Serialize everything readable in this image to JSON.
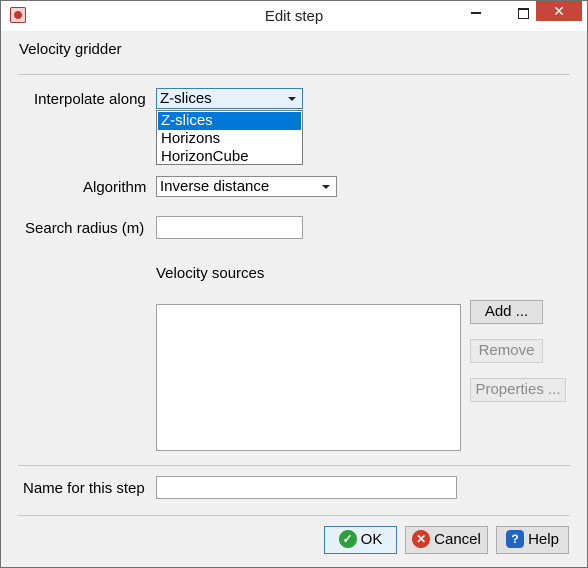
{
  "window": {
    "title": "Edit step",
    "minimize_label": "",
    "close_label": "✕"
  },
  "section_title": "Velocity gridder",
  "interpolate": {
    "label": "Interpolate along",
    "selected": "Z-slices",
    "options": [
      "Z-slices",
      "Horizons",
      "HorizonCube"
    ]
  },
  "algorithm": {
    "label": "Algorithm",
    "selected": "Inverse distance"
  },
  "search_radius": {
    "label": "Search radius (m)",
    "value": ""
  },
  "velocity_sources": {
    "label": "Velocity sources",
    "add_label": "Add ...",
    "remove_label": "Remove",
    "properties_label": "Properties ..."
  },
  "step_name": {
    "label": "Name for this step",
    "value": ""
  },
  "buttons": {
    "ok_label": "OK",
    "cancel_label": "Cancel",
    "help_label": "Help",
    "ok_icon": "checkmark-icon",
    "cancel_icon": "cancel-icon",
    "help_icon": "help-icon"
  },
  "colors": {
    "selection": "#0078d7",
    "close_button": "#c7463a"
  }
}
